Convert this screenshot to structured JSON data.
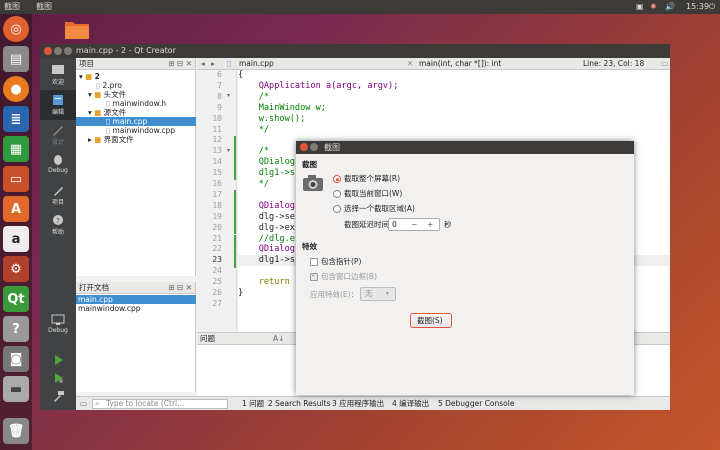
{
  "top_panel": {
    "app_name": "截图",
    "menu_item": "截图",
    "clock": "15:39"
  },
  "launcher": {
    "items": [
      "dash-icon",
      "files-icon",
      "firefox-icon",
      "writer-icon",
      "calc-icon",
      "impress-icon",
      "software-center-icon",
      "amazon-icon",
      "settings-icon",
      "qt-creator-icon",
      "help-icon",
      "screenshot-icon",
      "drive-icon",
      "trash-icon"
    ]
  },
  "qt": {
    "title": "main.cpp - 2 - Qt Creator",
    "modes": [
      "欢迎",
      "编辑",
      "设计",
      "Debug",
      "项目",
      "帮助"
    ],
    "kit_label": "Debug",
    "project_header": "项目",
    "tree": [
      "2",
      "2.pro",
      "头文件",
      "mainwindow.h",
      "源文件",
      "main.cpp",
      "mainwindow.cpp",
      "界面文件"
    ],
    "open_docs_header": "打开文档",
    "open_docs": [
      "main.cpp",
      "mainwindow.cpp"
    ],
    "editor_file": "main.cpp",
    "function": "main(int, char *[]): int",
    "position": "Line: 23, Col: 18",
    "line_numbers": [
      "6",
      "7",
      "8",
      "9",
      "10",
      "11",
      "12",
      "13",
      "14",
      "15",
      "16",
      "17",
      "18",
      "19",
      "20",
      "21",
      "22",
      "23",
      "24",
      "25",
      "26",
      "27"
    ],
    "code": {
      "l6": "{",
      "l7a": "    QApplication a(argc, argv);",
      "l8": "    /*",
      "l9": "    MainWindow w;",
      "l10": "    w.show();",
      "l11": "    */",
      "l12": "",
      "l13": "    /*",
      "l14": "    QDialog",
      "l15": "    dlg1->s",
      "l16": "    */",
      "l17": "",
      "l18": "    QDialog",
      "l19": "    dlg->se",
      "l20": "    dlg->ex",
      "l21": "    //dlg.e",
      "l22": "    QDialog",
      "l23": "    dlg1->s",
      "l24": "",
      "l25a": "    return",
      "l26": "}",
      "l27": ""
    },
    "output_header": "问题",
    "locator_placeholder": "Type to locate (Ctrl...",
    "status_tabs": [
      "1 问题",
      "2 Search Results",
      "3 应用程序输出",
      "4 编译输出",
      "5 Debugger Console"
    ]
  },
  "dialog": {
    "title": "截图",
    "section_capture": "截图",
    "opt_full": "截取整个屏幕(R)",
    "opt_window": "截取当前窗口(W)",
    "opt_area": "选择一个截取区域(A)",
    "delay_label": "截图延迟时间(D)",
    "delay_value": "0",
    "delay_unit": "秒",
    "section_effects": "特效",
    "include_pointer": "包含指针(P)",
    "include_border": "包含窗口边框(B)",
    "apply_effect_label": "应用特效(E)：",
    "effect_value": "无",
    "capture_button": "截图(S)"
  }
}
